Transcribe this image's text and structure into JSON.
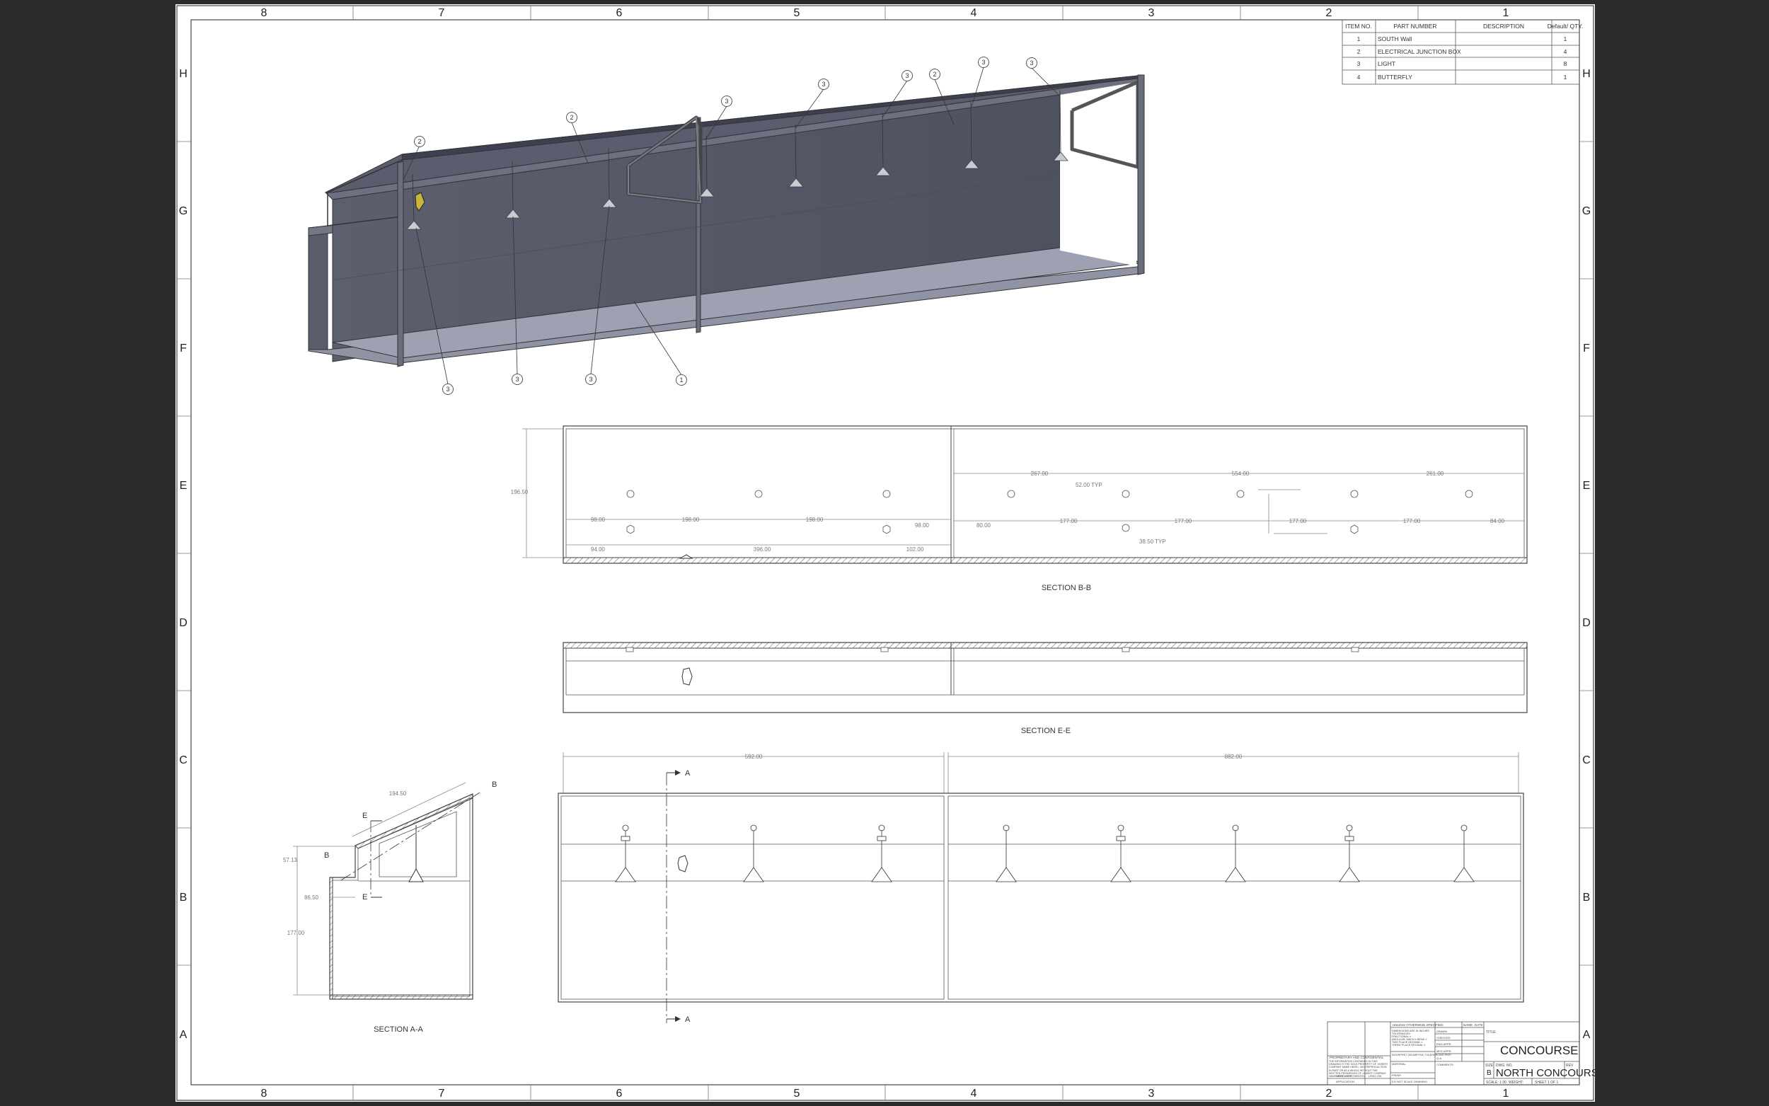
{
  "zones": {
    "columns": [
      "8",
      "7",
      "6",
      "5",
      "4",
      "3",
      "2",
      "1"
    ],
    "rows": [
      "H",
      "G",
      "F",
      "E",
      "D",
      "C",
      "B",
      "A"
    ]
  },
  "bom": {
    "headers": [
      "ITEM NO.",
      "PART NUMBER",
      "DESCRIPTION",
      "Default/ QTY."
    ],
    "rows": [
      {
        "item": "1",
        "part": "SOUTH Wall",
        "desc": "",
        "qty": "1"
      },
      {
        "item": "2",
        "part": "ELECTRICAL JUNCTION BOX",
        "desc": "",
        "qty": "4"
      },
      {
        "item": "3",
        "part": "LIGHT",
        "desc": "",
        "qty": "8"
      },
      {
        "item": "4",
        "part": "BUTTERFLY",
        "desc": "",
        "qty": "1"
      }
    ]
  },
  "balloons": [
    "2",
    "2",
    "3",
    "3",
    "3",
    "2",
    "3",
    "3",
    "3",
    "3",
    "3",
    "1"
  ],
  "section_bb": {
    "title": "SECTION B-B",
    "dims": {
      "height": "196.50",
      "d98a": "98.00",
      "d198a": "198.00",
      "d198b": "198.00",
      "d98b": "98.00",
      "d94": "94.00",
      "d396": "396.00",
      "d102": "102.00",
      "d267": "267.00",
      "d554": "554.00",
      "d261": "261.00",
      "d80": "80.00",
      "d177a": "177.00",
      "d177b": "177.00",
      "d177c": "177.00",
      "d177d": "177.00",
      "d84": "84.00",
      "typ52": "52.00 TYP",
      "typ38": "38.50 TYP"
    }
  },
  "section_ee": {
    "title": "SECTION E-E"
  },
  "section_aa": {
    "title": "SECTION A-A",
    "dims": {
      "slope": "194.50",
      "h57": "57.13",
      "d86": "86.50",
      "h177": "177.00"
    },
    "markers": {
      "e": "E",
      "b": "B"
    }
  },
  "elevation": {
    "dims": {
      "left": "592.00",
      "right": "882.00"
    },
    "marker": "A"
  },
  "title_block": {
    "unless": "UNLESS OTHERWISE SPECIFIED:",
    "name": "NAME",
    "date": "DATE",
    "rows": [
      "DRAWN",
      "CHECKED",
      "ENG APPR.",
      "MFG APPR.",
      "Q.A.",
      "COMMENTS:"
    ],
    "notes": [
      "DIMENSIONS ARE IN INCHES",
      "TOLERANCES:",
      "FRACTIONAL ±",
      "ANGULAR: MACH ±   BEND ±",
      "TWO PLACE DECIMAL  ±",
      "THREE PLACE DECIMAL  ±"
    ],
    "interp": "INTERPRET GEOMETRIC TOLERANCING PER:",
    "material": "MATERIAL",
    "finish": "FINISH",
    "next_assy": "NEXT ASSY",
    "used_on": "USED ON",
    "application": "APPLICATION",
    "do_not_scale": "DO NOT SCALE DRAWING",
    "proprietary": "PROPRIETARY AND CONFIDENTIAL",
    "proprietary_text": "THE INFORMATION CONTAINED IN THIS DRAWING IS THE SOLE PROPERTY OF <INSERT COMPANY NAME HERE>. ANY REPRODUCTION IN PART OR AS A WHOLE WITHOUT THE WRITTEN PERMISSION OF <INSERT COMPANY NAME HERE> IS PROHIBITED.",
    "title_label": "TITLE:",
    "title": "CONCOURSE",
    "size_label": "SIZE",
    "size": "B",
    "dwg_label": "DWG. NO.",
    "rev_label": "REV",
    "dwg": "NORTH CONCOURSE",
    "scale": "SCALE: 1:30",
    "weight": "WEIGHT:",
    "sheet": "SHEET 1 OF 1"
  }
}
